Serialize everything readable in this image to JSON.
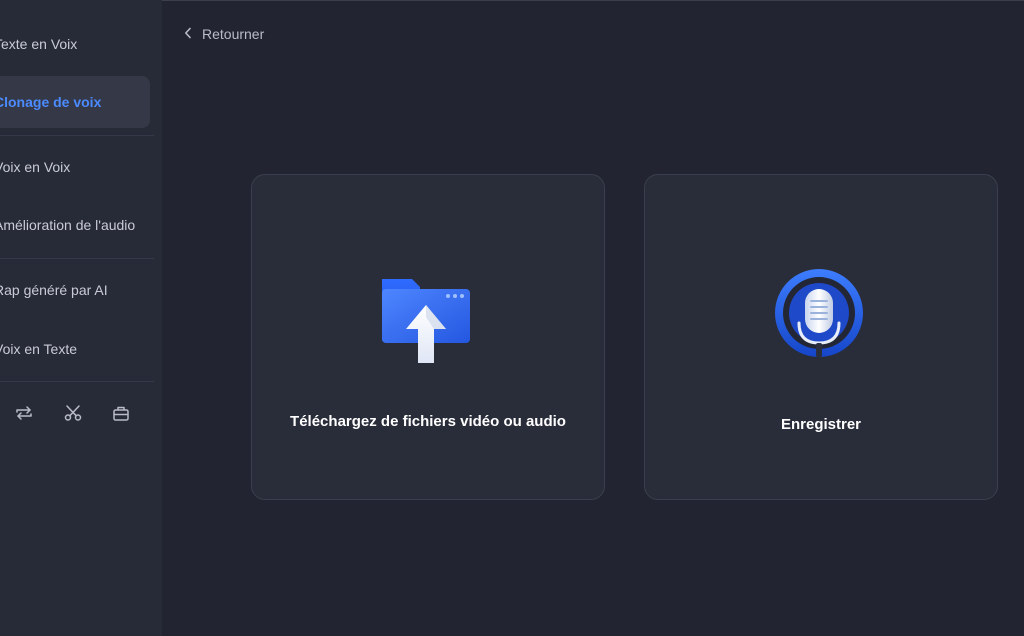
{
  "sidebar": {
    "items": [
      {
        "label": "Texte en Voix",
        "active": false
      },
      {
        "label": "Clonage de voix",
        "active": true
      },
      {
        "label": "Voix en Voix",
        "active": false
      },
      {
        "label": "Amélioration de l'audio",
        "active": false
      },
      {
        "label": "Rap généré par AI",
        "active": false
      },
      {
        "label": "Voix en Texte",
        "active": false
      }
    ],
    "bottom_icons": [
      "repeat-icon",
      "scissors-icon",
      "toolbox-icon"
    ]
  },
  "header": {
    "back_label": "Retourner",
    "back_icon": "chevron-left-icon"
  },
  "main": {
    "cards": [
      {
        "label": "Téléchargez de fichiers vidéo ou audio",
        "icon": "folder-upload-icon"
      },
      {
        "label": "Enregistrer",
        "icon": "microphone-icon"
      }
    ]
  },
  "colors": {
    "background": "#222531",
    "sidebar": "#272a37",
    "accent": "#4b8bff",
    "card": "#292c39"
  }
}
